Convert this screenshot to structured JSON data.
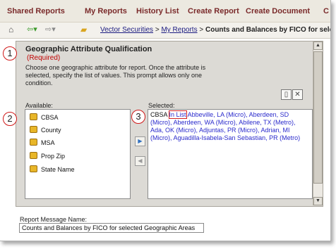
{
  "nav": {
    "items": [
      "Shared Reports",
      "My Reports",
      "History List",
      "Create Report",
      "Create Document",
      "C"
    ]
  },
  "breadcrumb": {
    "items": [
      "Vector Securities",
      "My Reports"
    ],
    "separator": ">",
    "current": "Counts and Balances by FICO for selec"
  },
  "prompt": {
    "number": "1",
    "title": "Geographic Attribute Qualification",
    "required": "(Required)",
    "description": "Choose one geographic attribute for report. Once the attribute is selected, specify the list of values. This prompt allows only one condition."
  },
  "available": {
    "number": "2",
    "label": "Available:",
    "items": [
      "CBSA",
      "County",
      "MSA",
      "Prop Zip",
      "State Name"
    ]
  },
  "selected": {
    "number": "3",
    "label": "Selected:",
    "attribute": "CBSA",
    "operator": "In List",
    "values": "Abbeville, LA (Micro), Aberdeen, SD (Micro), Aberdeen, WA (Micro), Abilene, TX (Metro), Ada, OK (Micro), Adjuntas, PR (Micro), Adrian, MI (Micro), Aguadilla-Isabela-San Sebastian, PR (Metro)"
  },
  "report_message": {
    "label": "Report Message Name:",
    "value": "Counts and Balances by FICO for selected Geographic Areas"
  },
  "icons": {
    "home": "home-icon",
    "back": "back-arrow-icon",
    "forward": "forward-arrow-icon",
    "folder": "folder-up-icon",
    "new": "new-document-icon",
    "clear": "clear-x-icon",
    "add": "add-arrow-icon",
    "remove": "remove-arrow-icon"
  },
  "colors": {
    "nav_text": "#7a2a2a",
    "link": "#1a1a80",
    "required": "#c00000",
    "callout": "#d01818",
    "selection_text": "#2a2acc"
  }
}
